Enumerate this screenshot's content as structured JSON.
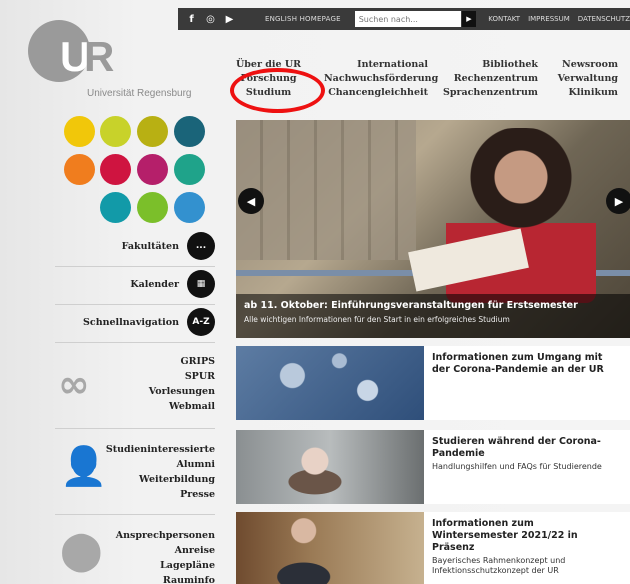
{
  "topbar": {
    "social": [
      "f",
      "ig",
      "yt"
    ],
    "english": "ENGLISH HOMEPAGE",
    "search_placeholder": "Suchen nach...",
    "links": [
      "KONTAKT",
      "IMPRESSUM",
      "DATENSCHUTZ"
    ]
  },
  "logo": {
    "mark_u": "U",
    "mark_r": "R",
    "text": "Universität Regensburg"
  },
  "nav": {
    "col1": [
      "Über die UR",
      "Forschung",
      "Studium"
    ],
    "col2": [
      "International",
      "Nachwuchsförderung",
      "Chancengleichheit"
    ],
    "col3": [
      "Bibliothek",
      "Rechenzentrum",
      "Sprachenzentrum"
    ],
    "col4": [
      "Newsroom",
      "Verwaltung",
      "Klinikum"
    ]
  },
  "colors": {
    "dots": [
      "#f1c70a",
      "#c8d22a",
      "#b8b013",
      "#1a6479",
      "#f07d1e",
      "#cf1440",
      "#b51f6a",
      "#1fa38a",
      "#129aa8",
      "#7bbf2a",
      "#3391cf"
    ],
    "highlight": "#e11111"
  },
  "leftmenu": {
    "fakultaeten": "Fakultäten",
    "kalender": "Kalender",
    "schnellnav": "Schnellnavigation",
    "az": "A-Z",
    "dots_icon": "...",
    "list1": [
      "GRIPS",
      "SPUR",
      "Vorlesungen",
      "Webmail"
    ],
    "list2": [
      "Studieninteressierte",
      "Alumni",
      "Weiterbildung",
      "Presse"
    ],
    "list3": [
      "Ansprechpersonen",
      "Anreise",
      "Lagepläne",
      "Rauminfo"
    ]
  },
  "hero": {
    "title": "ab 11. Oktober: Einführungsveranstaltungen für Erstsemester",
    "subtitle": "Alle wichtigen Informationen für den Start in ein erfolgreiches Studium"
  },
  "news": [
    {
      "title": "Informationen zum Umgang mit der Corona-Pandemie an der UR",
      "text": ""
    },
    {
      "title": "Studieren während der Corona-Pandemie",
      "text": "Handlungshilfen und FAQs für Studierende"
    },
    {
      "title": "Informationen zum Wintersemester 2021/22 in Präsenz",
      "text": "Bayerisches Rahmenkonzept und Infektionsschutzkonzept der UR"
    }
  ]
}
